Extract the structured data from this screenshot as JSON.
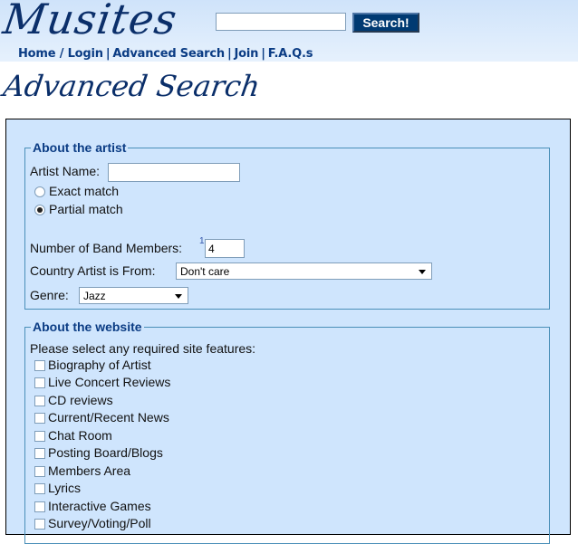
{
  "header": {
    "logo": "Musites",
    "search": {
      "value": "",
      "placeholder": ""
    },
    "search_button": "Search!",
    "nav": [
      "Home / Login",
      "Advanced Search",
      "Join",
      "F.A.Q.s"
    ]
  },
  "page_title": "Advanced Search",
  "about_artist": {
    "legend": "About the artist",
    "artist_name_label": "Artist Name:",
    "artist_name_value": "",
    "match_options": [
      {
        "label": "Exact match",
        "checked": false
      },
      {
        "label": "Partial match",
        "checked": true
      }
    ],
    "band_members_label": "Number of Band Members:",
    "band_members_sup": "1",
    "band_members_value": "4",
    "country_label": "Country Artist is From:",
    "country_value": "Don't care",
    "genre_label": "Genre:",
    "genre_value": "Jazz"
  },
  "about_website": {
    "legend": "About the website",
    "prompt": "Please select any required site features:",
    "features": [
      "Biography of Artist",
      "Live Concert Reviews",
      "CD reviews",
      "Current/Recent News",
      "Chat Room",
      "Posting Board/Blogs",
      "Members Area",
      "Lyrics",
      "Interactive Games",
      "Survey/Voting/Poll"
    ]
  }
}
